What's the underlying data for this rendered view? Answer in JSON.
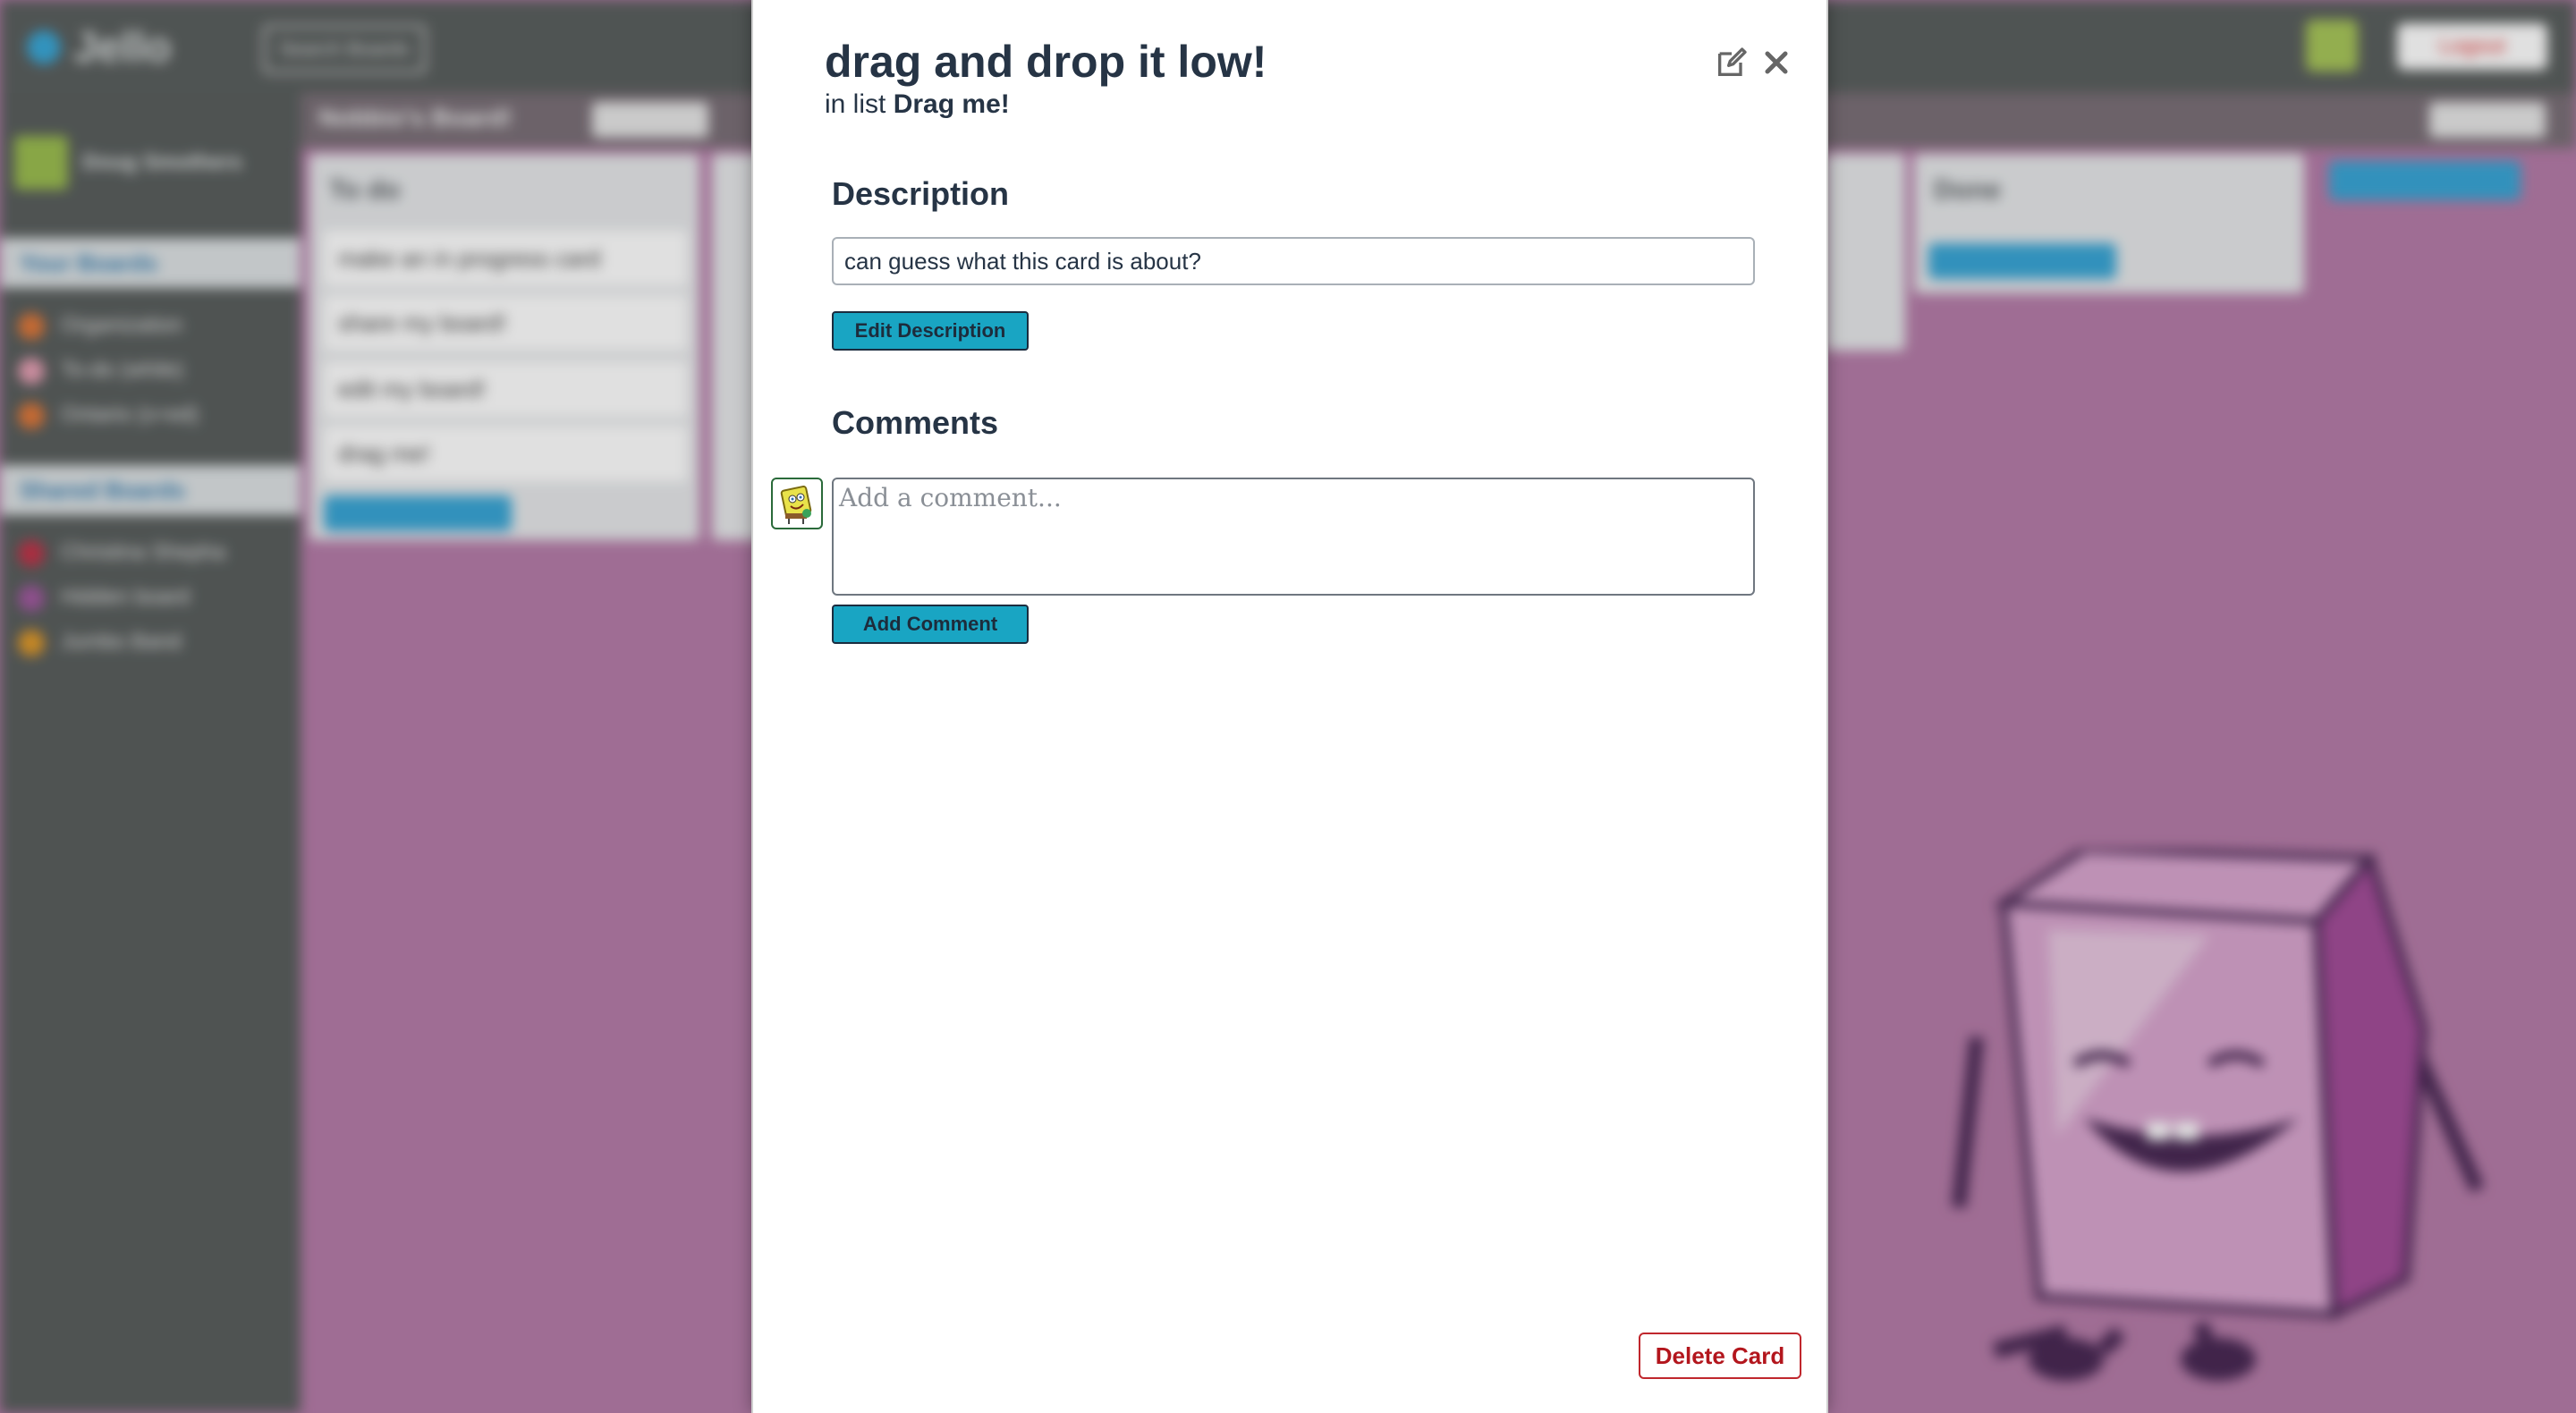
{
  "app": {
    "logo_text": "Jello",
    "search_label": "Search Boards",
    "logout_label": "Logout"
  },
  "sidebar": {
    "user_name": "Doug Smothers",
    "your_boards_label": "Your Boards",
    "your_boards": [
      {
        "label": "Organization",
        "color": "#e0793a"
      },
      {
        "label": "To-do (while)",
        "color": "#e6a0b4"
      },
      {
        "label": "Ontario (s+ed)",
        "color": "#e0793a"
      }
    ],
    "shared_boards_label": "Shared Boards",
    "shared_boards": [
      {
        "label": "Christina Shepha",
        "color": "#c2344a"
      },
      {
        "label": "Hidden board",
        "color": "#a15aa0"
      },
      {
        "label": "Jumbo Band",
        "color": "#e09a2a"
      }
    ]
  },
  "board": {
    "title": "Nobbio's Board!",
    "lists": [
      {
        "title": "To do",
        "cards": [
          "make an in progress card",
          "share my board!",
          "edit my board!",
          "drag me!"
        ]
      },
      {
        "title": "Done"
      }
    ]
  },
  "card": {
    "title": "drag and drop it low!",
    "in_list_prefix": "in list",
    "list_name": "Drag me!",
    "edit_icon": "pencil-square-icon",
    "close_icon": "close-x-icon",
    "description_heading": "Description",
    "description_text": "can guess what this card is about?",
    "edit_description_label": "Edit Description",
    "comments_heading": "Comments",
    "comment_placeholder": "Add a comment...",
    "add_comment_label": "Add Comment",
    "delete_label": "Delete Card"
  },
  "colors": {
    "board_background": "#b67da9",
    "accent_teal": "#19a5c3",
    "title_navy": "#263445",
    "danger_red": "#b3161d"
  }
}
